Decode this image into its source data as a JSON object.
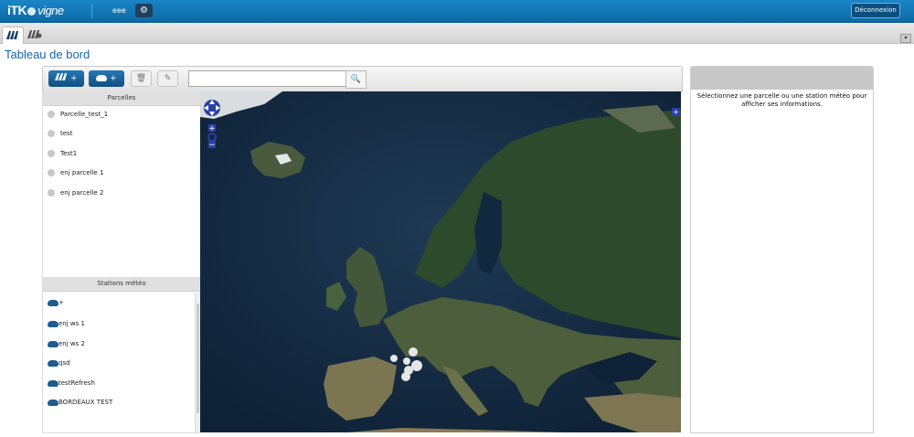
{
  "header": {
    "logo_itk": "iTK",
    "logo_vigne": "vigne",
    "user": "eee",
    "settings_icon": "gear-icon",
    "logout_label": "Déconnexion"
  },
  "tabs": [
    {
      "icon": "vineyard-icon",
      "active": true
    },
    {
      "icon": "vineyard-weather-icon",
      "active": false
    }
  ],
  "page": {
    "title": "Tableau de bord"
  },
  "toolbar": {
    "add_parcel_label": "+",
    "add_station_label": "+",
    "search_placeholder": "",
    "search_value": ""
  },
  "parcels_section": {
    "header": "Parcelles",
    "items": [
      "Parcelle_test_1",
      "test",
      "Test1",
      "enj parcelle 1",
      "enj parcelle 2"
    ]
  },
  "stations_section": {
    "header": "Stations météo",
    "items": [
      "+",
      "enj ws 1",
      "enj ws 2",
      "qsd",
      "testRefresh",
      "BORDEAUX TEST"
    ]
  },
  "map": {
    "zoom_in": "+",
    "zoom_out": "−",
    "expand_label": "+"
  },
  "info_panel": {
    "message": "Sélectionnez une parcelle ou une station météo pour afficher ses informations."
  },
  "colors": {
    "header_blue": "#0c6aa6",
    "title_blue": "#1566a8",
    "button_blue": "#104f82"
  }
}
